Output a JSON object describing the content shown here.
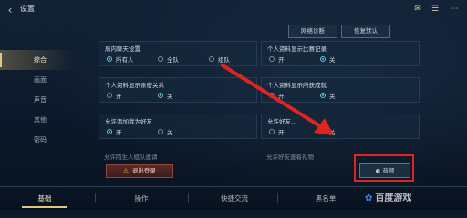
{
  "header": {
    "title": "设置",
    "back_icon": "back-arrow-icon",
    "icons": [
      "mail-icon",
      "chat-icon",
      "more-icon"
    ]
  },
  "top_buttons": {
    "network": "网络诊断",
    "restore": "恢复默认"
  },
  "sidebar": {
    "items": [
      {
        "label": "综合",
        "active": true
      },
      {
        "label": "画面",
        "active": false
      },
      {
        "label": "声音",
        "active": false
      },
      {
        "label": "其他",
        "active": false
      },
      {
        "label": "密码",
        "active": false
      }
    ]
  },
  "panels": [
    {
      "title": "局内聊天设置",
      "options": [
        "所有人",
        "全队",
        "组队"
      ],
      "selected": 0
    },
    {
      "title": "个人资料显示比赛记录",
      "options": [
        "开",
        "关"
      ],
      "selected": 1
    },
    {
      "title": "个人资料显示亲密关系",
      "options": [
        "开",
        "关"
      ],
      "selected": 1
    },
    {
      "title": "个人资料显示所获成就",
      "options": [
        "开",
        "关"
      ],
      "selected": 1
    },
    {
      "title": "允许添加我为好友",
      "options": [
        "开",
        "关"
      ],
      "selected": 0
    },
    {
      "title": "允许好友...",
      "options": [
        "开",
        "关"
      ],
      "selected": 1
    }
  ],
  "partial_rows": [
    "允许陌生人组队邀请",
    "允许好友查看礼物"
  ],
  "logout_label": "退出登录",
  "voice_label": "音频",
  "bottom_tabs": [
    {
      "label": "基础",
      "active": true
    },
    {
      "label": "操作",
      "active": false
    },
    {
      "label": "快捷交流",
      "active": false
    },
    {
      "label": "黑名单",
      "active": false
    }
  ],
  "watermark": "百度游戏",
  "colors": {
    "accent": "#e0c784",
    "highlight": "#e0241f",
    "radio_on": "#63c6d8"
  }
}
